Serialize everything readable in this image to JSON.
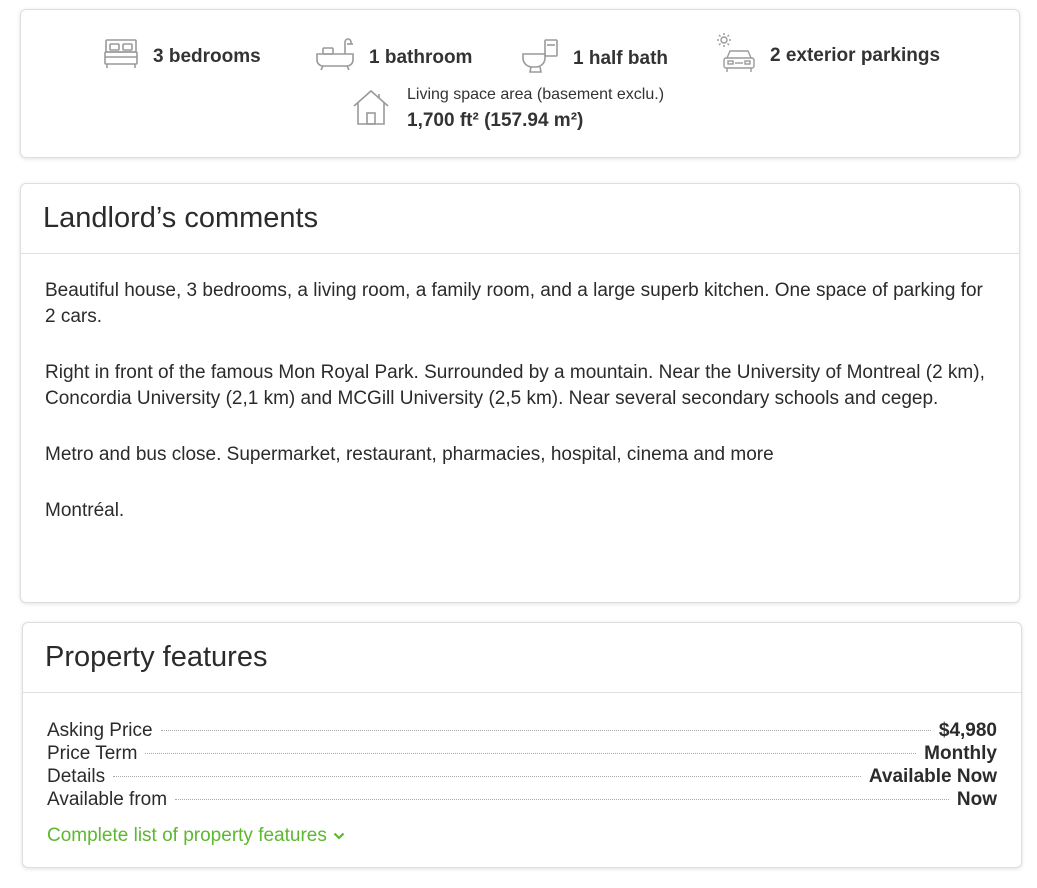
{
  "stats": {
    "bedrooms": {
      "label": "3 bedrooms",
      "icon": "bed-icon"
    },
    "bathrooms": {
      "label": "1 bathroom",
      "icon": "bathtub-icon"
    },
    "half_bath": {
      "label": "1 half bath",
      "icon": "toilet-icon"
    },
    "parking": {
      "label": "2 exterior parkings",
      "icon": "car-sun-icon"
    },
    "area": {
      "caption": "Living space area (basement exclu.)",
      "value": "1,700 ft² (157.94 m²)",
      "icon": "house-icon"
    }
  },
  "comments": {
    "title": "Landlord’s comments",
    "paragraphs": [
      "Beautiful house, 3 bedrooms, a living room, a family room, and a large superb kitchen. One space of parking for 2 cars.",
      "Right in front of the famous Mon Royal Park. Surrounded by a mountain. Near the University of Montreal (2 km), Concordia University (2,1 km) and MCGill University (2,5 km). Near several secondary schools and cegep.",
      "Metro and bus close. Supermarket, restaurant, pharmacies, hospital, cinema and more",
      "Montréal."
    ]
  },
  "features": {
    "title": "Property features",
    "rows": [
      {
        "label": "Asking Price",
        "value": "$4,980"
      },
      {
        "label": "Price Term",
        "value": "Monthly"
      },
      {
        "label": "Details",
        "value": "Available Now"
      },
      {
        "label": "Available from",
        "value": "Now"
      }
    ],
    "more_link": "Complete list of property features",
    "more_icon": "chevron-down-icon"
  },
  "colors": {
    "link": "#5cb82e",
    "icon": "#9a9a9a",
    "border": "#dedede"
  }
}
